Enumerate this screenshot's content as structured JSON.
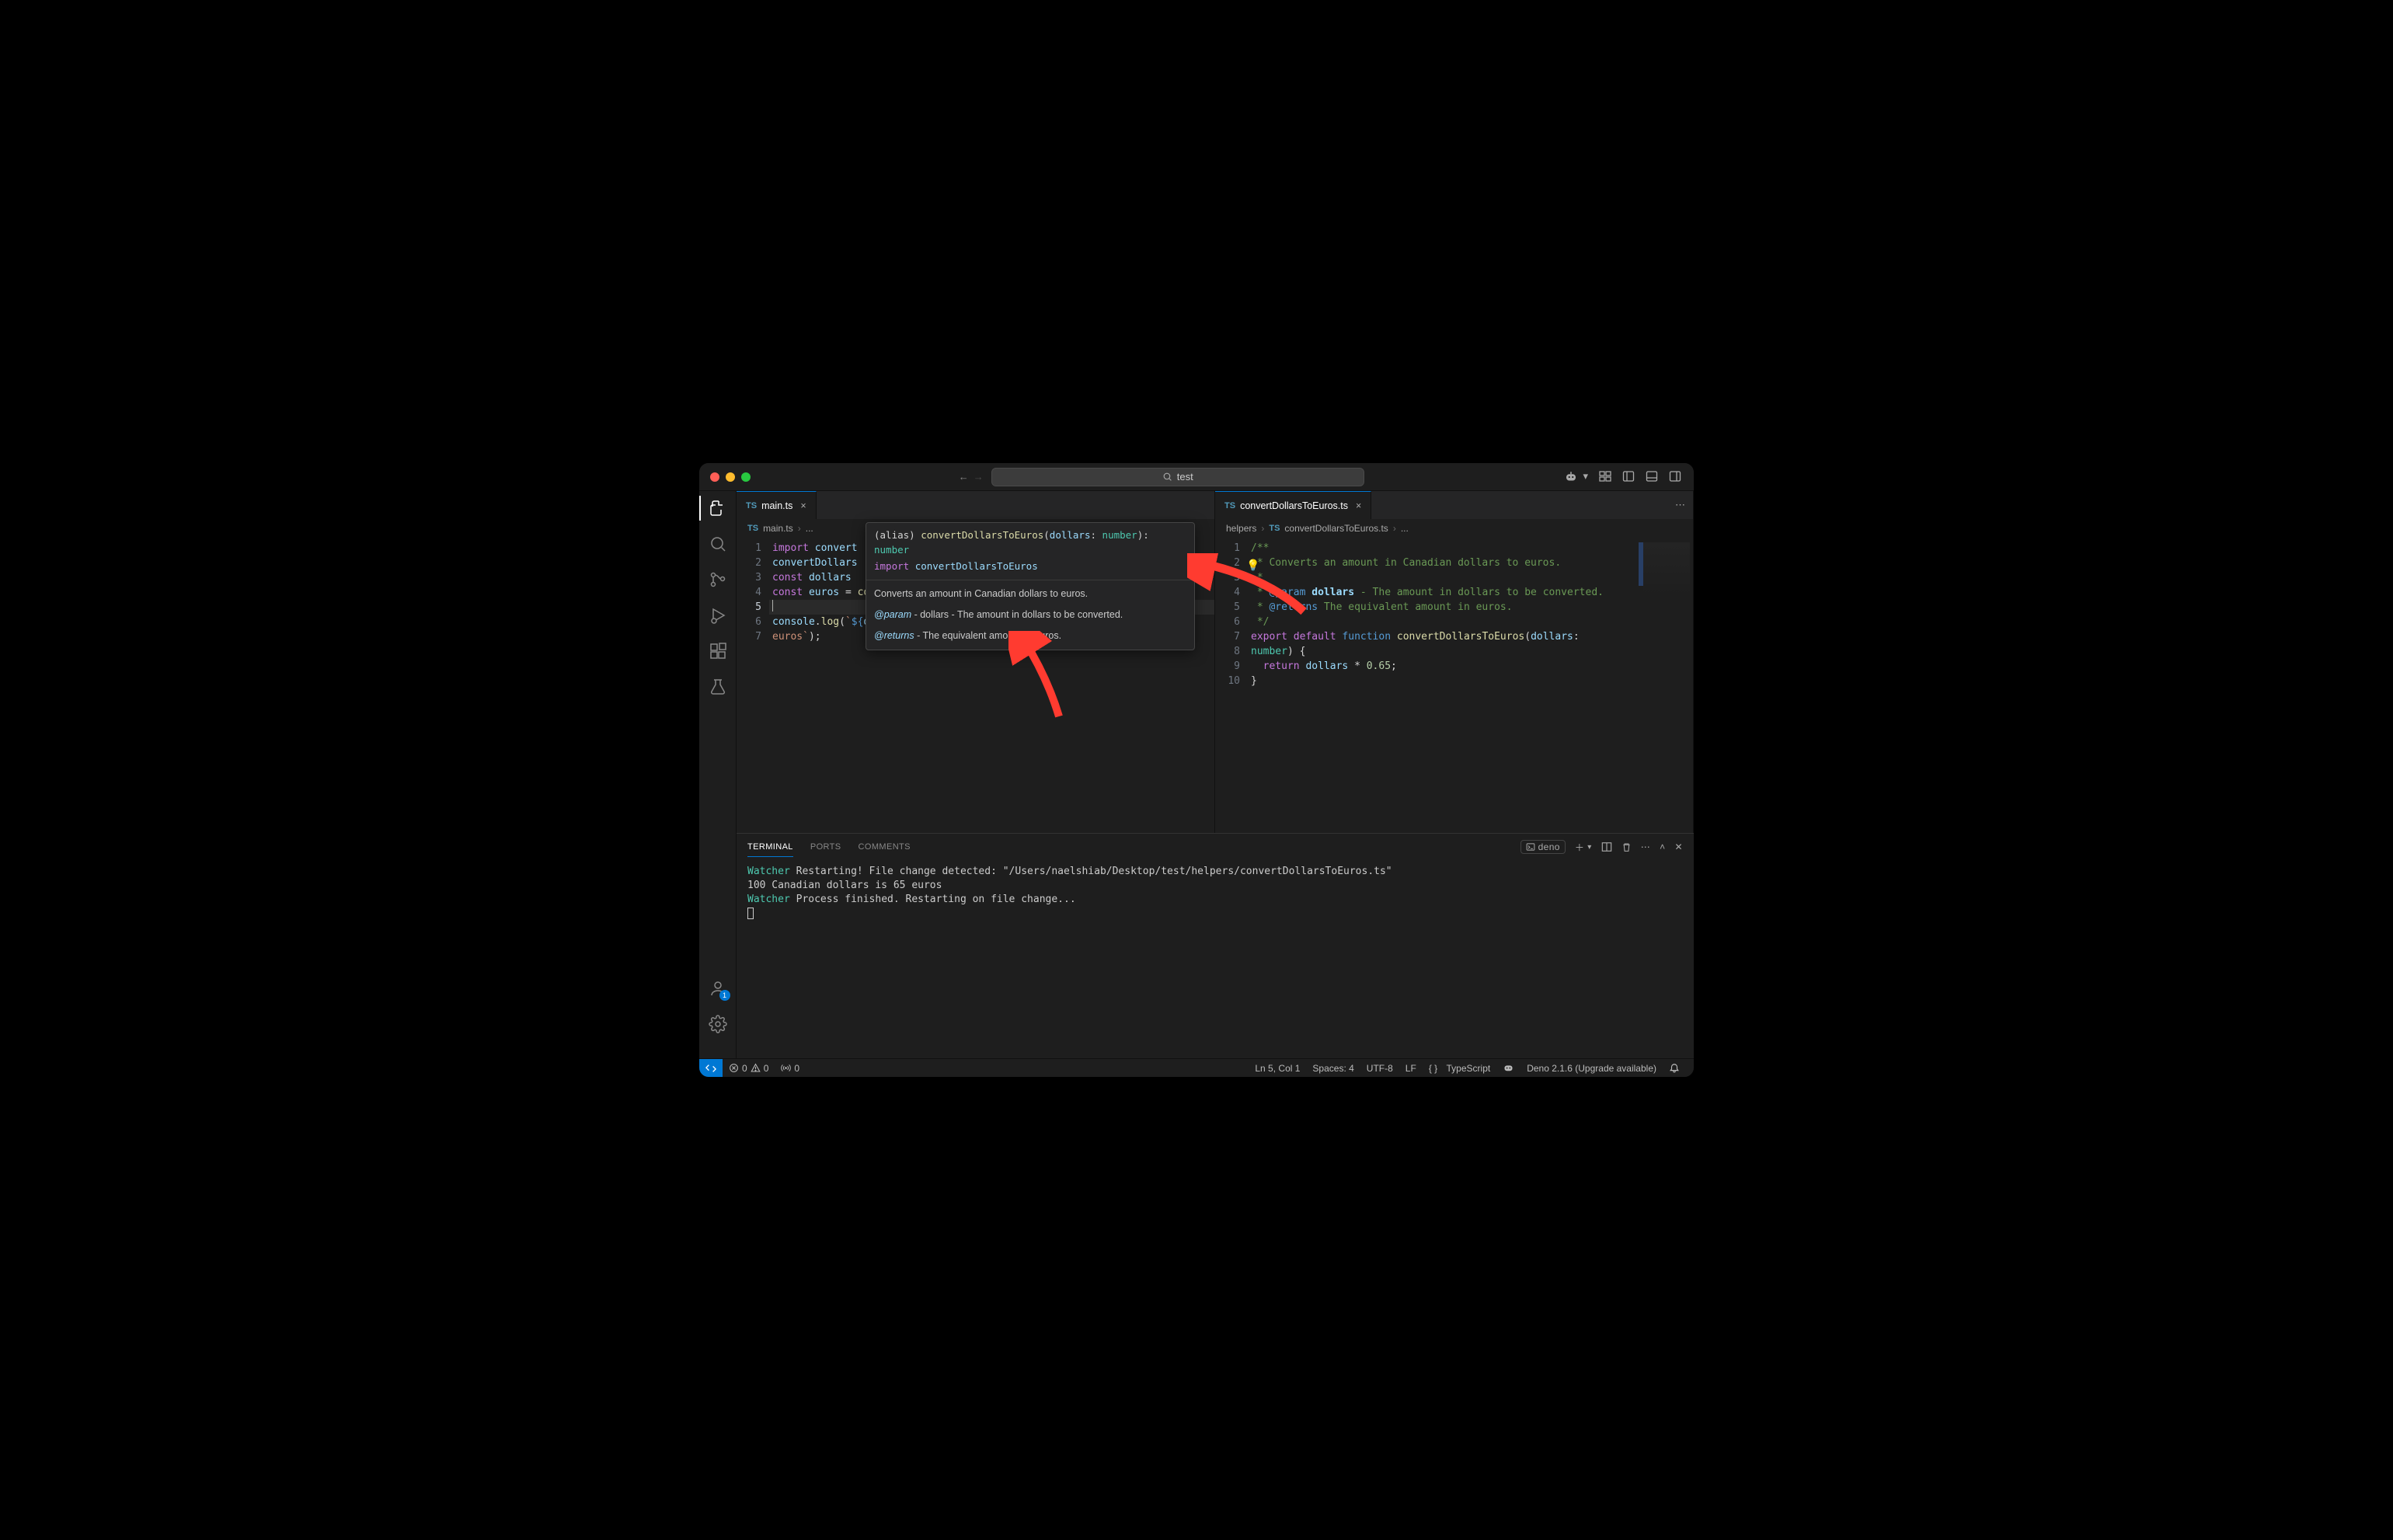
{
  "titlebar": {
    "search_text": "test"
  },
  "activity": {
    "account_badge": "1"
  },
  "left_editor": {
    "tab_label": "main.ts",
    "crumb_file": "main.ts",
    "crumb_more": "...",
    "lines": [
      "1",
      "2",
      "3",
      "4",
      "5",
      "6",
      "7"
    ],
    "code_plain": [
      "import convertDollarsToEuros from \"./helpers/convertDollarsToEuros.ts\";",
      "",
      "const dollars = 100;",
      "const euros = convertDollarsToEuros(dollars);",
      "",
      "console.log(`${dollars} Canadian dollars is ${euros} euros`);",
      ""
    ]
  },
  "hover": {
    "signature": "(alias) convertDollarsToEuros(dollars: number): number",
    "import_kw": "import",
    "import_name": "convertDollarsToEuros",
    "desc": "Converts an amount in Canadian dollars to euros.",
    "param_tag": "@param",
    "param_text": " - dollars - The amount in dollars to be converted.",
    "returns_tag": "@returns",
    "returns_text": " - The equivalent amount in euros."
  },
  "right_editor": {
    "tab_label": "convertDollarsToEuros.ts",
    "crumb_folder": "helpers",
    "crumb_file": "convertDollarsToEuros.ts",
    "crumb_more": "...",
    "lines": [
      "1",
      "2",
      "3",
      "4",
      "5",
      "6",
      "7",
      "8",
      "9",
      "10"
    ],
    "code_plain": [
      "/**",
      " * Converts an amount in Canadian dollars to euros.",
      " *",
      " * @param dollars - The amount in dollars to be converted.",
      " * @returns The equivalent amount in euros.",
      " */",
      "export default function convertDollarsToEuros(dollars: number) {",
      "  return dollars * 0.65;",
      "}",
      ""
    ]
  },
  "panel": {
    "tabs": [
      "TERMINAL",
      "PORTS",
      "COMMENTS"
    ],
    "active_tab": "TERMINAL",
    "terminal_label": "deno",
    "output_watch1": "Watcher",
    "output_line1": " Restarting! File change detected: \"/Users/naelshiab/Desktop/test/helpers/convertDollarsToEuros.ts\"",
    "output_line2": "100 Canadian dollars is 65 euros",
    "output_watch2": "Watcher",
    "output_line3": " Process finished. Restarting on file change..."
  },
  "status": {
    "errors": "0",
    "warnings": "0",
    "ports": "0",
    "lncol": "Ln 5, Col 1",
    "spaces": "Spaces: 4",
    "encoding": "UTF-8",
    "eol": "LF",
    "lang": "TypeScript",
    "deno": "Deno 2.1.6 (Upgrade available)"
  }
}
